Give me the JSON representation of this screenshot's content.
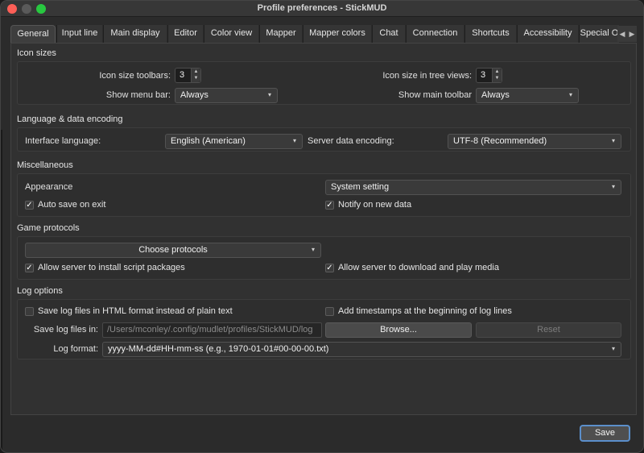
{
  "window": {
    "title": "Profile preferences - StickMUD"
  },
  "tabs": [
    {
      "label": "General",
      "active": true
    },
    {
      "label": "Input line"
    },
    {
      "label": "Main display"
    },
    {
      "label": "Editor"
    },
    {
      "label": "Color view"
    },
    {
      "label": "Mapper"
    },
    {
      "label": "Mapper colors"
    },
    {
      "label": "Chat"
    },
    {
      "label": "Connection"
    },
    {
      "label": "Shortcuts"
    },
    {
      "label": "Accessibility"
    },
    {
      "label": "Special O"
    }
  ],
  "icon_sizes": {
    "title": "Icon sizes",
    "toolbars_label": "Icon size toolbars:",
    "toolbars_value": "3",
    "tree_label": "Icon size in tree views:",
    "tree_value": "3",
    "menu_bar_label": "Show menu bar:",
    "menu_bar_value": "Always",
    "main_toolbar_label": "Show main toolbar",
    "main_toolbar_value": "Always"
  },
  "language": {
    "title": "Language & data encoding",
    "interface_label": "Interface language:",
    "interface_value": "English (American)",
    "encoding_label": "Server data encoding:",
    "encoding_value": "UTF-8 (Recommended)"
  },
  "misc": {
    "title": "Miscellaneous",
    "appearance_label": "Appearance",
    "appearance_value": "System setting",
    "auto_save_label": "Auto save on exit",
    "auto_save_checked": true,
    "notify_label": "Notify on new data",
    "notify_checked": true
  },
  "protocols": {
    "title": "Game protocols",
    "choose_label": "Choose protocols",
    "install_label": "Allow server to install script packages",
    "install_checked": true,
    "media_label": "Allow server to download and play media",
    "media_checked": true
  },
  "log": {
    "title": "Log options",
    "html_label": "Save log files in HTML format instead of plain text",
    "html_checked": false,
    "timestamps_label": "Add timestamps at the beginning of log lines",
    "timestamps_checked": false,
    "path_label": "Save log files in:",
    "path_value": "/Users/mconley/.config/mudlet/profiles/StickMUD/log",
    "browse_label": "Browse...",
    "reset_label": "Reset",
    "format_label": "Log format:",
    "format_value": "yyyy-MM-dd#HH-mm-ss (e.g., 1970-01-01#00-00-00.txt)"
  },
  "footer": {
    "save_label": "Save"
  },
  "icons": {
    "chevron": "▾",
    "check": "✓",
    "up": "▲",
    "down": "▼",
    "left": "◀",
    "right": "▶"
  },
  "colors": {
    "accent": "#5b8fcb",
    "close": "#fe5f57",
    "maximize": "#28c840"
  }
}
